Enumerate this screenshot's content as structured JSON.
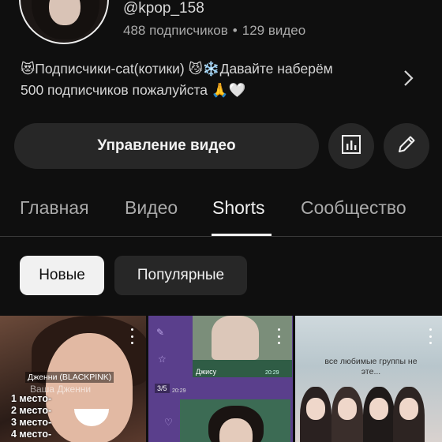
{
  "channel": {
    "handle": "@kpop_158",
    "subscribers": "488 подписчиков",
    "separator": "•",
    "videos": "129 видео",
    "description_line1": "😻Подписчики-cat(котики) 😼❄️Давайте наберём",
    "description_line2": "500 подписчиков пожалуйста 🙏🤍"
  },
  "actions": {
    "manage_label": "Управление видео",
    "stats_icon": "analytics-icon",
    "edit_icon": "pencil-icon"
  },
  "tabs": [
    {
      "label": "Главная"
    },
    {
      "label": "Видео"
    },
    {
      "label": "Shorts",
      "active": true
    },
    {
      "label": "Сообщество"
    }
  ],
  "filters": [
    {
      "label": "Новые",
      "selected": true
    },
    {
      "label": "Популярные",
      "selected": false
    }
  ],
  "shorts": [
    {
      "label_top": "Дженни (BLACKPINK)",
      "label_sub": "Ваша Дженни",
      "list": [
        "1 место-",
        "2 место-",
        "3 место-",
        "4 место-"
      ]
    },
    {
      "name": "Джису",
      "time1": "20:29",
      "pager": "3/5",
      "time2": "20:29"
    },
    {
      "caption": "все любимые группы не эте..."
    }
  ],
  "colors": {
    "background": "#0f0f0f",
    "surface": "#272727",
    "text_primary": "#f1f1f1",
    "text_secondary": "#aaaaaa"
  }
}
